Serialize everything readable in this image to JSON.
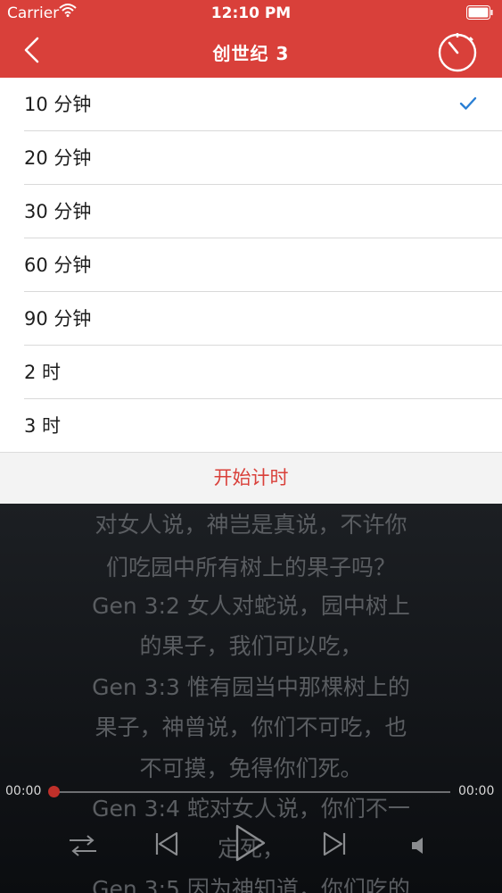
{
  "status_bar": {
    "carrier": "Carrier",
    "time": "12:10 PM"
  },
  "nav": {
    "title": "创世纪 3"
  },
  "timer_options": [
    {
      "label": "10 分钟",
      "selected": true
    },
    {
      "label": "20 分钟",
      "selected": false
    },
    {
      "label": "30 分钟",
      "selected": false
    },
    {
      "label": "60 分钟",
      "selected": false
    },
    {
      "label": "90 分钟",
      "selected": false
    },
    {
      "label": "2 时",
      "selected": false
    },
    {
      "label": "3 时",
      "selected": false
    }
  ],
  "start_button": "开始计时",
  "reader_lines": [
    "对女人说，神岂是真说，不许你",
    "们吃园中所有树上的果子吗？",
    "Gen 3:2 女人对蛇说，园中树上",
    "的果子，我们可以吃，",
    "Gen 3:3 惟有园当中那棵树上的",
    "果子，神曾说，你们不可吃，也",
    "不可摸，免得你们死。",
    "Gen 3:4 蛇对女人说，你们不一",
    "定死，",
    "Gen 3:5 因为神知道，你们吃的"
  ],
  "player": {
    "elapsed": "00:00",
    "duration": "00:00",
    "progress": 0
  },
  "colors": {
    "accent": "#d9403a",
    "check": "#2a7fd4"
  },
  "icons": [
    "back-chevron-icon",
    "stopwatch-icon",
    "checkmark-icon",
    "shuffle-icon",
    "skip-back-icon",
    "play-icon",
    "skip-forward-icon",
    "volume-icon",
    "wifi-icon",
    "battery-icon"
  ]
}
